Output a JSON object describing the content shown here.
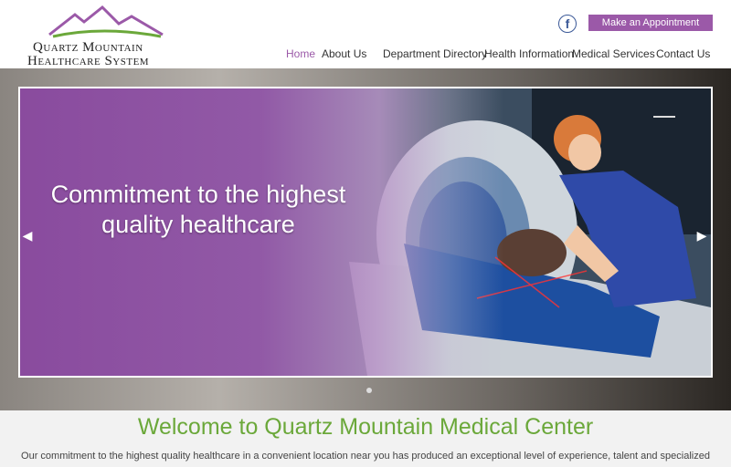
{
  "header": {
    "logo": {
      "line1": "Quartz Mountain",
      "line2": "Healthcare System"
    },
    "facebook_icon": "facebook-icon",
    "facebook_glyph": "f",
    "appointment_label": "Make an Appointment"
  },
  "nav": {
    "items": [
      "Home",
      "About Us",
      "Department Directory",
      "Health Information",
      "Medical Services",
      "Contact Us"
    ],
    "active": "Home"
  },
  "hero": {
    "caption_line1": "Commitment to the highest",
    "caption_line2": "quality healthcare",
    "prev_glyph": "◀",
    "next_glyph": "▶",
    "slide_count": 1
  },
  "welcome": {
    "title": "Welcome to Quartz Mountain Medical Center",
    "text": "Our commitment to the highest quality healthcare in a convenient location near you has produced an exceptional level of experience, talent and specialized"
  },
  "colors": {
    "accent": "#9b59a8",
    "green": "#6ba83a",
    "facebook": "#3b5998"
  }
}
